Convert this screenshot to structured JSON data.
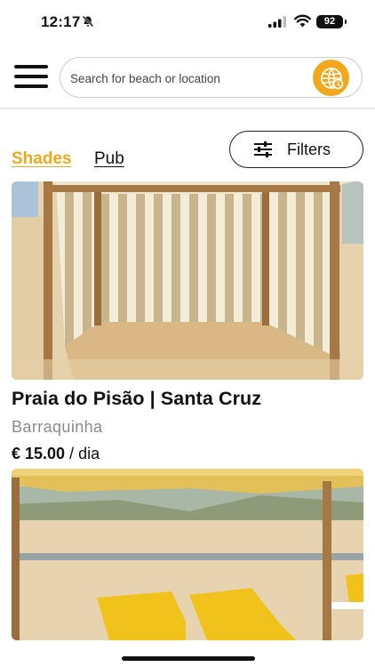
{
  "status_bar": {
    "time": "12:17",
    "battery": "92"
  },
  "header": {
    "search_placeholder": "Search for beach or location",
    "menu_icon": "hamburger-menu-icon",
    "globe_icon": "globe-icon",
    "accent_color": "#f2a81d"
  },
  "tabs": [
    {
      "label": "Shades",
      "active": true
    },
    {
      "label": "Pub",
      "active": false
    }
  ],
  "filters": {
    "label": "Filters",
    "icon": "sliders-icon"
  },
  "listings": [
    {
      "title": "Praia do Pisão | Santa Cruz",
      "subtitle": "Barraquinha",
      "price_amount": "€ 15.00",
      "price_unit": "/ dia"
    }
  ]
}
